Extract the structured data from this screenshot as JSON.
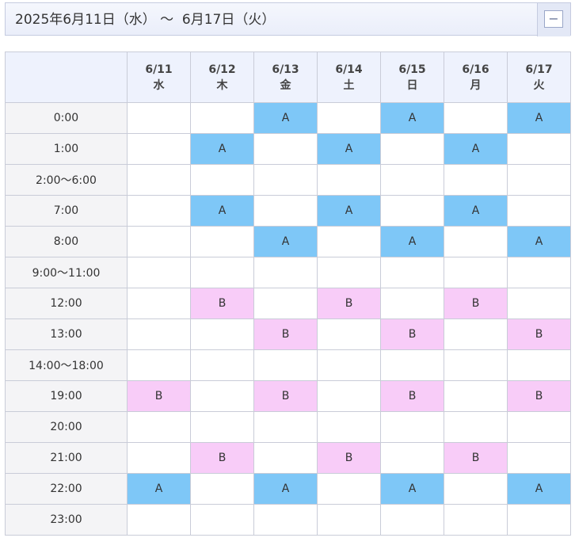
{
  "header": {
    "title": "2025年6月11日（水） ～  6月17日（火）",
    "collapse_symbol": "−"
  },
  "colors": {
    "A": "#7ec7f7",
    "B": "#f8ccf8",
    "header_bg": "#eef2fd",
    "time_bg": "#f4f4f6"
  },
  "days": [
    {
      "date": "6/11",
      "weekday": "水"
    },
    {
      "date": "6/12",
      "weekday": "木"
    },
    {
      "date": "6/13",
      "weekday": "金"
    },
    {
      "date": "6/14",
      "weekday": "土"
    },
    {
      "date": "6/15",
      "weekday": "日"
    },
    {
      "date": "6/16",
      "weekday": "月"
    },
    {
      "date": "6/17",
      "weekday": "火"
    }
  ],
  "rows": [
    {
      "time": "0:00",
      "cells": [
        "",
        "",
        "A",
        "",
        "A",
        "",
        "A"
      ]
    },
    {
      "time": "1:00",
      "cells": [
        "",
        "A",
        "",
        "A",
        "",
        "A",
        ""
      ]
    },
    {
      "time": "2:00～6:00",
      "cells": [
        "",
        "",
        "",
        "",
        "",
        "",
        ""
      ]
    },
    {
      "time": "7:00",
      "cells": [
        "",
        "A",
        "",
        "A",
        "",
        "A",
        ""
      ]
    },
    {
      "time": "8:00",
      "cells": [
        "",
        "",
        "A",
        "",
        "A",
        "",
        "A"
      ]
    },
    {
      "time": "9:00～11:00",
      "cells": [
        "",
        "",
        "",
        "",
        "",
        "",
        ""
      ]
    },
    {
      "time": "12:00",
      "cells": [
        "",
        "B",
        "",
        "B",
        "",
        "B",
        ""
      ]
    },
    {
      "time": "13:00",
      "cells": [
        "",
        "",
        "B",
        "",
        "B",
        "",
        "B"
      ]
    },
    {
      "time": "14:00～18:00",
      "cells": [
        "",
        "",
        "",
        "",
        "",
        "",
        ""
      ]
    },
    {
      "time": "19:00",
      "cells": [
        "B",
        "",
        "B",
        "",
        "B",
        "",
        "B"
      ]
    },
    {
      "time": "20:00",
      "cells": [
        "",
        "",
        "",
        "",
        "",
        "",
        ""
      ]
    },
    {
      "time": "21:00",
      "cells": [
        "",
        "B",
        "",
        "B",
        "",
        "B",
        ""
      ]
    },
    {
      "time": "22:00",
      "cells": [
        "A",
        "",
        "A",
        "",
        "A",
        "",
        "A"
      ]
    },
    {
      "time": "23:00",
      "cells": [
        "",
        "",
        "",
        "",
        "",
        "",
        ""
      ]
    }
  ]
}
